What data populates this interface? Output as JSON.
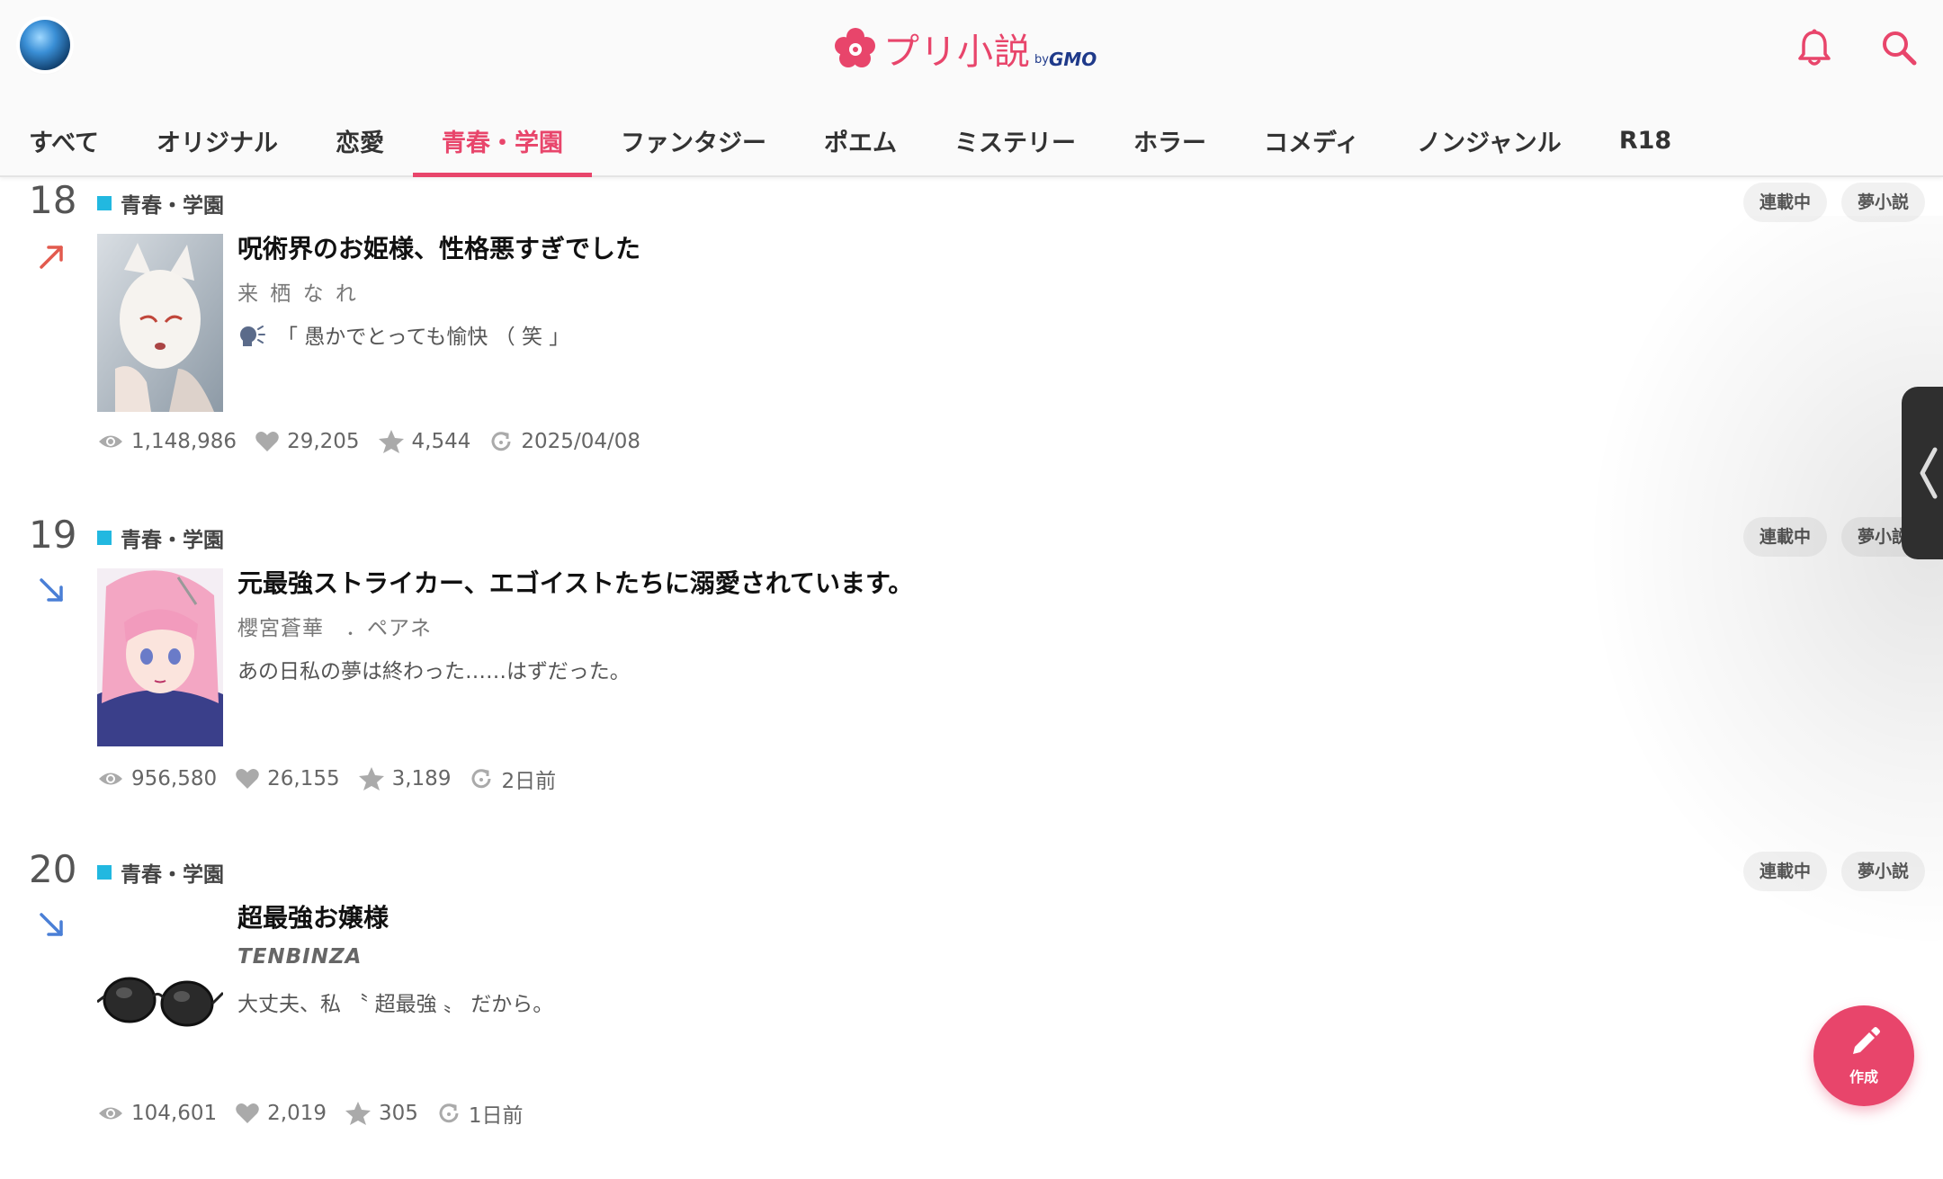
{
  "header": {
    "logo_text": "プリ小説",
    "logo_by": "by",
    "logo_gmo": "GMO",
    "brand_color": "#e8456b",
    "bell_icon": "bell-icon",
    "search_icon": "search-icon"
  },
  "tabs": [
    {
      "label": "すべて",
      "active": false
    },
    {
      "label": "オリジナル",
      "active": false
    },
    {
      "label": "恋愛",
      "active": false
    },
    {
      "label": "青春・学園",
      "active": true
    },
    {
      "label": "ファンタジー",
      "active": false
    },
    {
      "label": "ポエム",
      "active": false
    },
    {
      "label": "ミステリー",
      "active": false
    },
    {
      "label": "ホラー",
      "active": false
    },
    {
      "label": "コメディ",
      "active": false
    },
    {
      "label": "ノンジャンル",
      "active": false
    },
    {
      "label": "R18",
      "active": false
    }
  ],
  "entries": [
    {
      "rank": "18",
      "trend": "up",
      "genre": "青春・学園",
      "badges": [
        "連載中",
        "夢小説"
      ],
      "title": "呪術界のお姫様、性格悪すぎでした",
      "author": "来 栖 な れ",
      "tagline": "「 愚かでとっても愉快 （ 笑 」",
      "has_speaker_icon": true,
      "views": "1,148,986",
      "likes": "29,205",
      "stars": "4,544",
      "updated": "2025/04/08"
    },
    {
      "rank": "19",
      "trend": "down",
      "genre": "青春・学園",
      "badges": [
        "連載中",
        "夢小説"
      ],
      "title": "元最強ストライカー、エゴイストたちに溺愛されています。",
      "author": "櫻宮蒼華　．ペアネ",
      "tagline": "あの日私の夢は終わった……はずだった。",
      "has_speaker_icon": false,
      "views": "956,580",
      "likes": "26,155",
      "stars": "3,189",
      "updated": "2日前"
    },
    {
      "rank": "20",
      "trend": "down",
      "genre": "青春・学園",
      "badges": [
        "連載中",
        "夢小説"
      ],
      "title": "超最強お嬢様",
      "author": "TENBINZA",
      "tagline": "大丈夫、私 〝 超最強 〟 だから。",
      "has_speaker_icon": false,
      "views": "104,601",
      "likes": "2,019",
      "stars": "305",
      "updated": "1日前"
    }
  ],
  "fab": {
    "label": "作成",
    "icon": "pencil-icon"
  },
  "side_handle": {
    "icon": "chevron-left-icon"
  }
}
